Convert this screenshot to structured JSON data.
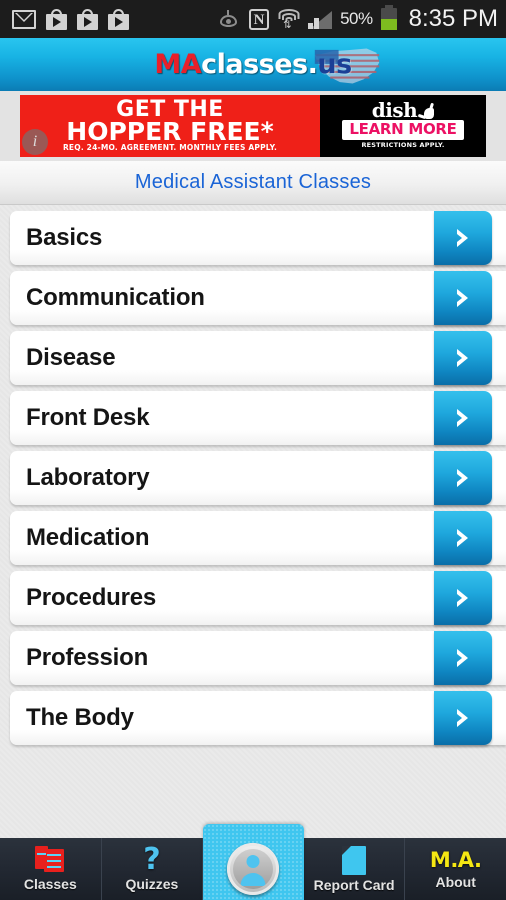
{
  "statusbar": {
    "icons_left": [
      "gmail-icon",
      "play-store-icon",
      "play-store-icon",
      "play-store-icon"
    ],
    "icons_right": [
      "eye-icon",
      "nfc-icon",
      "wifi-icon",
      "signal-icon"
    ],
    "battery_percent": "50%",
    "time": "8:35 PM"
  },
  "header": {
    "logo_ma": "MA",
    "logo_classes": "classes.",
    "logo_us": "us"
  },
  "ad": {
    "line1": "GET THE",
    "line2": "HOPPER FREE*",
    "fine_print": "REQ. 24-MO. AGREEMENT. MONTHLY FEES APPLY.",
    "brand": "dish",
    "cta": "LEARN MORE",
    "restrictions": "RESTRICTIONS APPLY.",
    "info_badge": "i"
  },
  "page": {
    "title": "Medical Assistant Classes"
  },
  "list": {
    "items": [
      {
        "label": "Basics"
      },
      {
        "label": "Communication"
      },
      {
        "label": "Disease"
      },
      {
        "label": "Front Desk"
      },
      {
        "label": "Laboratory"
      },
      {
        "label": "Medication"
      },
      {
        "label": "Procedures"
      },
      {
        "label": "Profession"
      },
      {
        "label": "The Body"
      }
    ]
  },
  "tabbar": {
    "items": [
      {
        "label": "Classes",
        "icon": "stacked-documents-icon",
        "active": true
      },
      {
        "label": "Quizzes",
        "icon": "question-mark-icon",
        "active": false
      },
      {
        "label": "",
        "icon": "profile-avatar-icon",
        "active": false
      },
      {
        "label": "Report Card",
        "icon": "page-icon",
        "active": false
      },
      {
        "label": "About",
        "icon": "ma-text-icon",
        "active": false
      }
    ],
    "about_glyph": "M.A.",
    "quiz_glyph": "?"
  },
  "colors": {
    "header_blue": "#18b3e4",
    "title_blue": "#1a64d6",
    "accent_cyan": "#3fc6ef",
    "ad_red": "#ef2018",
    "cta_pink": "#ec1164",
    "about_yellow": "#f5e713",
    "classes_red": "#e8201d",
    "battery_green": "#7dbc1f"
  }
}
